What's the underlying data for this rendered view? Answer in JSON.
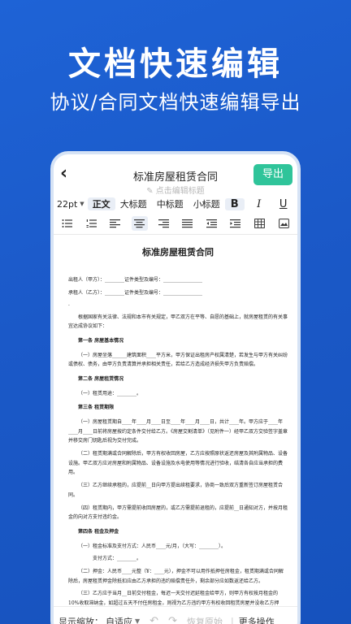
{
  "hero": {
    "title": "文档快速编辑",
    "subtitle": "协议/合同文档快速编辑导出"
  },
  "header": {
    "back_icon": "‹",
    "doc_title": "标准房屋租赁合同",
    "edit_hint": "✎ 点击编辑标题",
    "export_label": "导出"
  },
  "toolbar": {
    "font_size": "22pt",
    "styles": [
      "正文",
      "大标题",
      "中标题",
      "小标题"
    ],
    "bold": "B",
    "italic": "I",
    "underline": "U"
  },
  "document": {
    "title": "标准房屋租赁合同",
    "lessor": "出租人（甲方）：________证件类型及编号：________________",
    "lessee": "承租人（乙方）：________证件类型及编号：________________",
    "dot": "·",
    "intro": "根据国家有关法律、法规和本市有关规定，甲乙双方在平等、自愿的基础上，就房屋租赁的有关事宜达成协议如下：",
    "art1": "第一条  房屋基本情况",
    "art1_p1": "（一）房屋坐落______建筑面积____平方米，甲方保证出租房产权属清楚，若发生与甲方有关纠纷或债权、债务，由甲方负责清算并承担相关责任，若给乙方造成经济损失甲方负责赔偿。",
    "art2": "第二条  房屋租赁情况",
    "art2_p1": "（一）租赁用途：________。",
    "art3": "第三条  租赁期限",
    "art3_p1": "（一）房屋租赁期自____年____月____日至____年____月____日，共计____年。甲方应于____年____月____日前将房屋按约定条件交付给乙方。《房屋交割清单》（见附件一）经甲乙双方交验签字盖章并移交房门钥匙后视为交付完成。",
    "art3_p2": "（二）租赁期满或合同解除后，甲方有权收回房屋，乙方应按照原状返还房屋及其附属物品、设备设施。甲乙双方应对房屋和附属物品、设备设施及水电使用等情况进行验收，结清各自应当承担的费用。",
    "art3_p3": "（三）乙方继续承租的，应提前__日向甲方提出续租要求，协商一致后双方重新签订房屋租赁合同。",
    "art3_p4": "（四）租赁期内，甲方需提前收回房屋的，或乙方需提前退租的，应提前__日通知对方，并按月租金的向对方支付违约金。",
    "art4": "第四条  租金及押金",
    "art4_p1": "（一）租金标准及支付方式：人民币____元/月，（大写：________）。",
    "art4_p1b": "支付方式：________。",
    "art4_p2": "（二）押金：人民币____元整（¥：____元），押金不可以用作抵押任房租金，租赁期满或合同解除后，房屋租赁押金除抵扣应由乙方承担的违约赔偿责任外，剩余部分应如数返还给乙方。",
    "art4_p3": "（三）乙方应于当月__日前交付租金，每迟一天交付迟延租金给甲方，则甲方有权按月租金的10%收取滞纳金，如超过五天不付任房租金，则视为乙方违约甲方有权收回租赁房屋并没收乙方押金。"
  },
  "bottom": {
    "zoom_label": "显示缩放：",
    "zoom_value": "自适应",
    "undo_icon": "↶",
    "redo_icon": "↷",
    "restore_label": "恢复原始",
    "separator": "|",
    "more_label": "更多操作"
  }
}
